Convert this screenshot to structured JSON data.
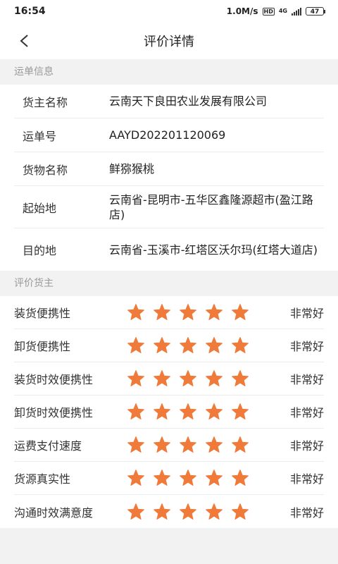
{
  "status_bar": {
    "time": "16:54",
    "network_speed": "1.0M/s",
    "hd": "HD",
    "network_type": "4G",
    "battery": "47"
  },
  "nav": {
    "title": "评价详情",
    "back_icon": "chevron-left-icon"
  },
  "waybill_section": {
    "header": "运单信息",
    "rows": [
      {
        "label": "货主名称",
        "value": "云南天下良田农业发展有限公司"
      },
      {
        "label": "运单号",
        "value": "AAYD202201120069"
      },
      {
        "label": "货物名称",
        "value": "鲜猕猴桃"
      },
      {
        "label": "起始地",
        "value": "云南省-昆明市-五华区鑫隆源超市(盈江路店)"
      },
      {
        "label": "目的地",
        "value": "云南省-玉溪市-红塔区沃尔玛(红塔大道店)"
      }
    ]
  },
  "rating_section": {
    "header": "评价货主",
    "star_color": "#f07a3a",
    "max_stars": 5,
    "rows": [
      {
        "label": "装货便携性",
        "stars": 5,
        "text": "非常好"
      },
      {
        "label": "卸货便携性",
        "stars": 5,
        "text": "非常好"
      },
      {
        "label": "装货时效便携性",
        "stars": 5,
        "text": "非常好"
      },
      {
        "label": "卸货时效便携性",
        "stars": 5,
        "text": "非常好"
      },
      {
        "label": "运费支付速度",
        "stars": 5,
        "text": "非常好"
      },
      {
        "label": "货源真实性",
        "stars": 5,
        "text": "非常好"
      },
      {
        "label": "沟通时效满意度",
        "stars": 5,
        "text": "非常好"
      }
    ]
  }
}
